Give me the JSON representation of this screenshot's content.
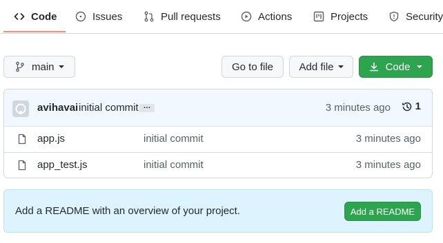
{
  "tabs": [
    {
      "label": "Code",
      "icon": "code-icon",
      "active": true
    },
    {
      "label": "Issues",
      "icon": "issue-icon"
    },
    {
      "label": "Pull requests",
      "icon": "pull-request-icon"
    },
    {
      "label": "Actions",
      "icon": "play-icon"
    },
    {
      "label": "Projects",
      "icon": "project-board-icon"
    },
    {
      "label": "Security",
      "icon": "shield-icon"
    }
  ],
  "toolbar": {
    "branch": "main",
    "go_to_file": "Go to file",
    "add_file": "Add file",
    "code": "Code"
  },
  "commit": {
    "author": "avihavai",
    "message": "initial commit",
    "ellipsis": "…",
    "time": "3 minutes ago",
    "count": "1"
  },
  "files": [
    {
      "name": "app.js",
      "message": "initial commit",
      "time": "3 minutes ago",
      "icon": "file-icon"
    },
    {
      "name": "app_test.js",
      "message": "initial commit",
      "time": "3 minutes ago",
      "icon": "file-icon"
    }
  ],
  "readme": {
    "text": "Add a README with an overview of your project.",
    "button": "Add a README"
  },
  "colors": {
    "accent_underline": "#fd8c73",
    "primary_green": "#2da44e",
    "commit_bg": "#f1f8ff",
    "banner_bg": "#ddf4ff"
  }
}
